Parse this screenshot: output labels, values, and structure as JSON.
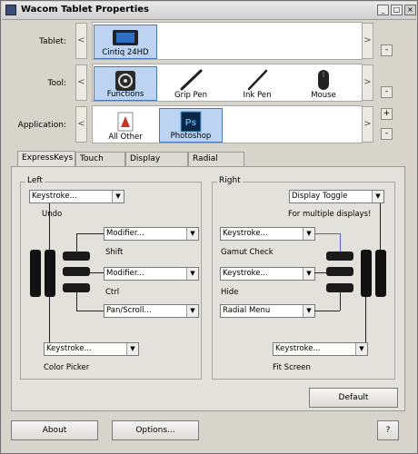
{
  "window": {
    "title": "Wacom Tablet Properties",
    "minimize_icon": "minimize-icon",
    "maximize_icon": "maximize-icon",
    "close_icon": "close-icon"
  },
  "rows": {
    "tablet": {
      "label": "Tablet:",
      "items": [
        {
          "label": "Cintiq 24HD",
          "icon": "tablet-icon",
          "selected": true
        }
      ]
    },
    "tool": {
      "label": "Tool:",
      "items": [
        {
          "label": "Functions",
          "icon": "functions-icon",
          "selected": true
        },
        {
          "label": "Grip Pen",
          "icon": "grip-pen-icon",
          "selected": false
        },
        {
          "label": "Ink Pen",
          "icon": "ink-pen-icon",
          "selected": false
        },
        {
          "label": "Mouse",
          "icon": "mouse-icon",
          "selected": false
        }
      ]
    },
    "application": {
      "label": "Application:",
      "items": [
        {
          "label": "All Other",
          "icon": "all-other-icon",
          "selected": false
        },
        {
          "label": "Photoshop",
          "icon": "photoshop-icon",
          "selected": true,
          "badge": "Ps"
        }
      ]
    },
    "add_label": "+",
    "remove_label": "-",
    "prev_arrow": "<",
    "next_arrow": ">"
  },
  "tabs": [
    {
      "label": "ExpressKeys",
      "active": true
    },
    {
      "label": "Touch Ring",
      "active": false
    },
    {
      "label": "Display Toggle",
      "active": false
    },
    {
      "label": "Radial Menu",
      "active": false
    }
  ],
  "left": {
    "label": "Left",
    "combo_top": "Keystroke...",
    "note_top": "Undo",
    "combo_1": "Modifier...",
    "note_1": "Shift",
    "combo_2": "Modifier...",
    "note_2": "Ctrl",
    "combo_3": "Pan/Scroll...",
    "combo_bottom": "Keystroke...",
    "note_bottom": "Color Picker"
  },
  "right": {
    "label": "Right",
    "combo_top": "Display Toggle",
    "note_top": "For multiple displays!",
    "combo_1": "Keystroke...",
    "note_1": "Gamut Check",
    "combo_2": "Keystroke...",
    "note_2": "Hide",
    "combo_3": "Radial Menu",
    "combo_bottom": "Keystroke...",
    "note_bottom": "Fit Screen"
  },
  "buttons": {
    "default": "Default",
    "about": "About",
    "options": "Options...",
    "help": "?"
  },
  "dropdown_glyph": "▼"
}
